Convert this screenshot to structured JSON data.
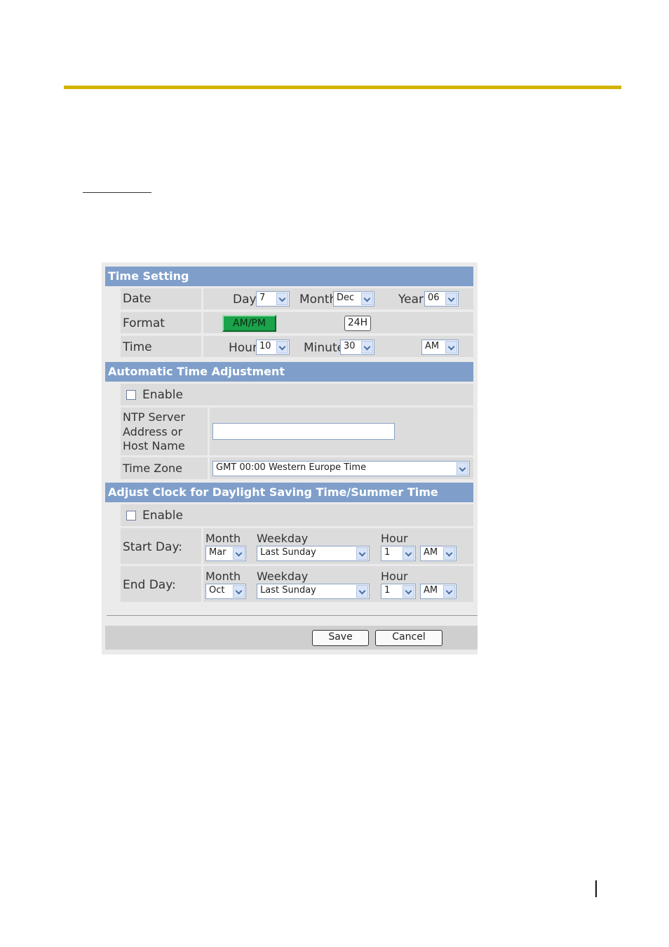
{
  "time_setting": {
    "title": "Time Setting",
    "date_label": "Date",
    "day_label": "Day",
    "day_value": "7",
    "month_label": "Month",
    "month_value": "Dec",
    "year_label": "Year",
    "year_value": "06",
    "format_label": "Format",
    "ampm_button": "AM/PM",
    "h24_button": "24H",
    "time_label": "Time",
    "hour_label": "Hour",
    "hour_value": "10",
    "minute_label": "Minute",
    "minute_value": "30",
    "ampm_value": "AM"
  },
  "auto_adjust": {
    "title": "Automatic Time Adjustment",
    "enable_label": "Enable",
    "ntp_label_1": "NTP Server",
    "ntp_label_2": "Address or",
    "ntp_label_3": "Host Name",
    "ntp_value": "",
    "timezone_label": "Time Zone",
    "timezone_value": "GMT 00:00 Western Europe Time"
  },
  "dst": {
    "title": "Adjust Clock for Daylight Saving Time/Summer Time",
    "enable_label": "Enable",
    "month_header": "Month",
    "weekday_header": "Weekday",
    "hour_header": "Hour",
    "start_label": "Start Day:",
    "start_month": "Mar",
    "start_weekday": "Last Sunday",
    "start_hour": "1",
    "start_ampm": "AM",
    "end_label": "End Day:",
    "end_month": "Oct",
    "end_weekday": "Last Sunday",
    "end_hour": "1",
    "end_ampm": "AM"
  },
  "footer": {
    "save_label": "Save",
    "cancel_label": "Cancel"
  },
  "colors": {
    "accent_rule": "#d4b200",
    "section_header": "#7f9fca",
    "active_button": "#1aa34a"
  }
}
